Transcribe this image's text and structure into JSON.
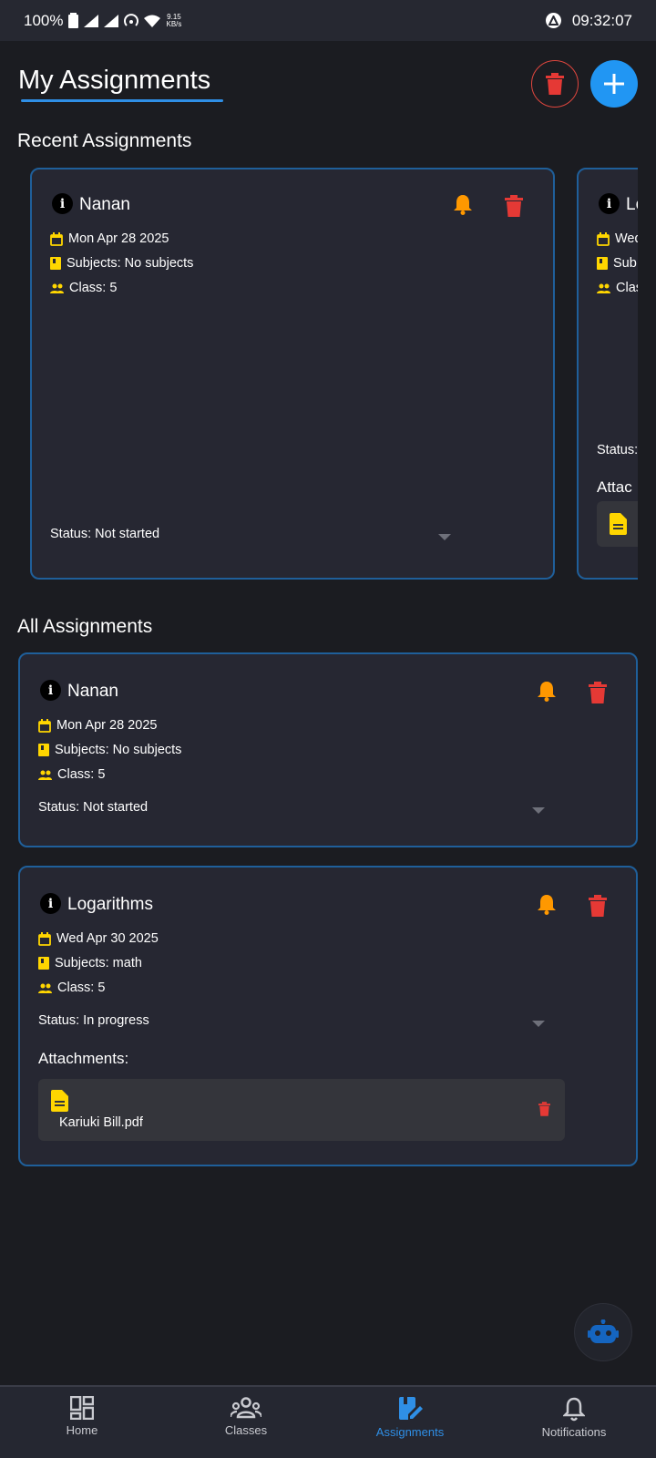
{
  "status_bar": {
    "battery": "100%",
    "net_speed_top": "9.15",
    "net_speed_bottom": "KB/s",
    "time": "09:32:07"
  },
  "header": {
    "title": "My Assignments"
  },
  "sections": {
    "recent": "Recent Assignments",
    "all": "All Assignments"
  },
  "recent_cards": [
    {
      "title": "Nanan",
      "date": "Mon Apr 28 2025",
      "subjects": "Subjects: No subjects",
      "class": "Class: 5",
      "status": "Status: Not started"
    },
    {
      "title": "Lo",
      "date": "Wed",
      "subjects": "Sub",
      "class": "Clas",
      "status": "Status:",
      "attachments_label": "Attac"
    }
  ],
  "all_cards": [
    {
      "title": "Nanan",
      "date": "Mon Apr 28 2025",
      "subjects": "Subjects: No subjects",
      "class": "Class: 5",
      "status": "Status: Not started"
    },
    {
      "title": "Logarithms",
      "date": "Wed Apr 30 2025",
      "subjects": "Subjects: math",
      "class": "Class: 5",
      "status": "Status: In progress",
      "attachments_label": "Attachments:",
      "attachment_file": "Kariuki Bill.pdf"
    }
  ],
  "nav": {
    "home": "Home",
    "classes": "Classes",
    "assignments": "Assignments",
    "notifications": "Notifications"
  },
  "colors": {
    "accent": "#2196f3",
    "danger": "#e53935",
    "bell": "#ff9800",
    "meta_icon": "#ffd600",
    "card_border": "#1f5f9a"
  }
}
